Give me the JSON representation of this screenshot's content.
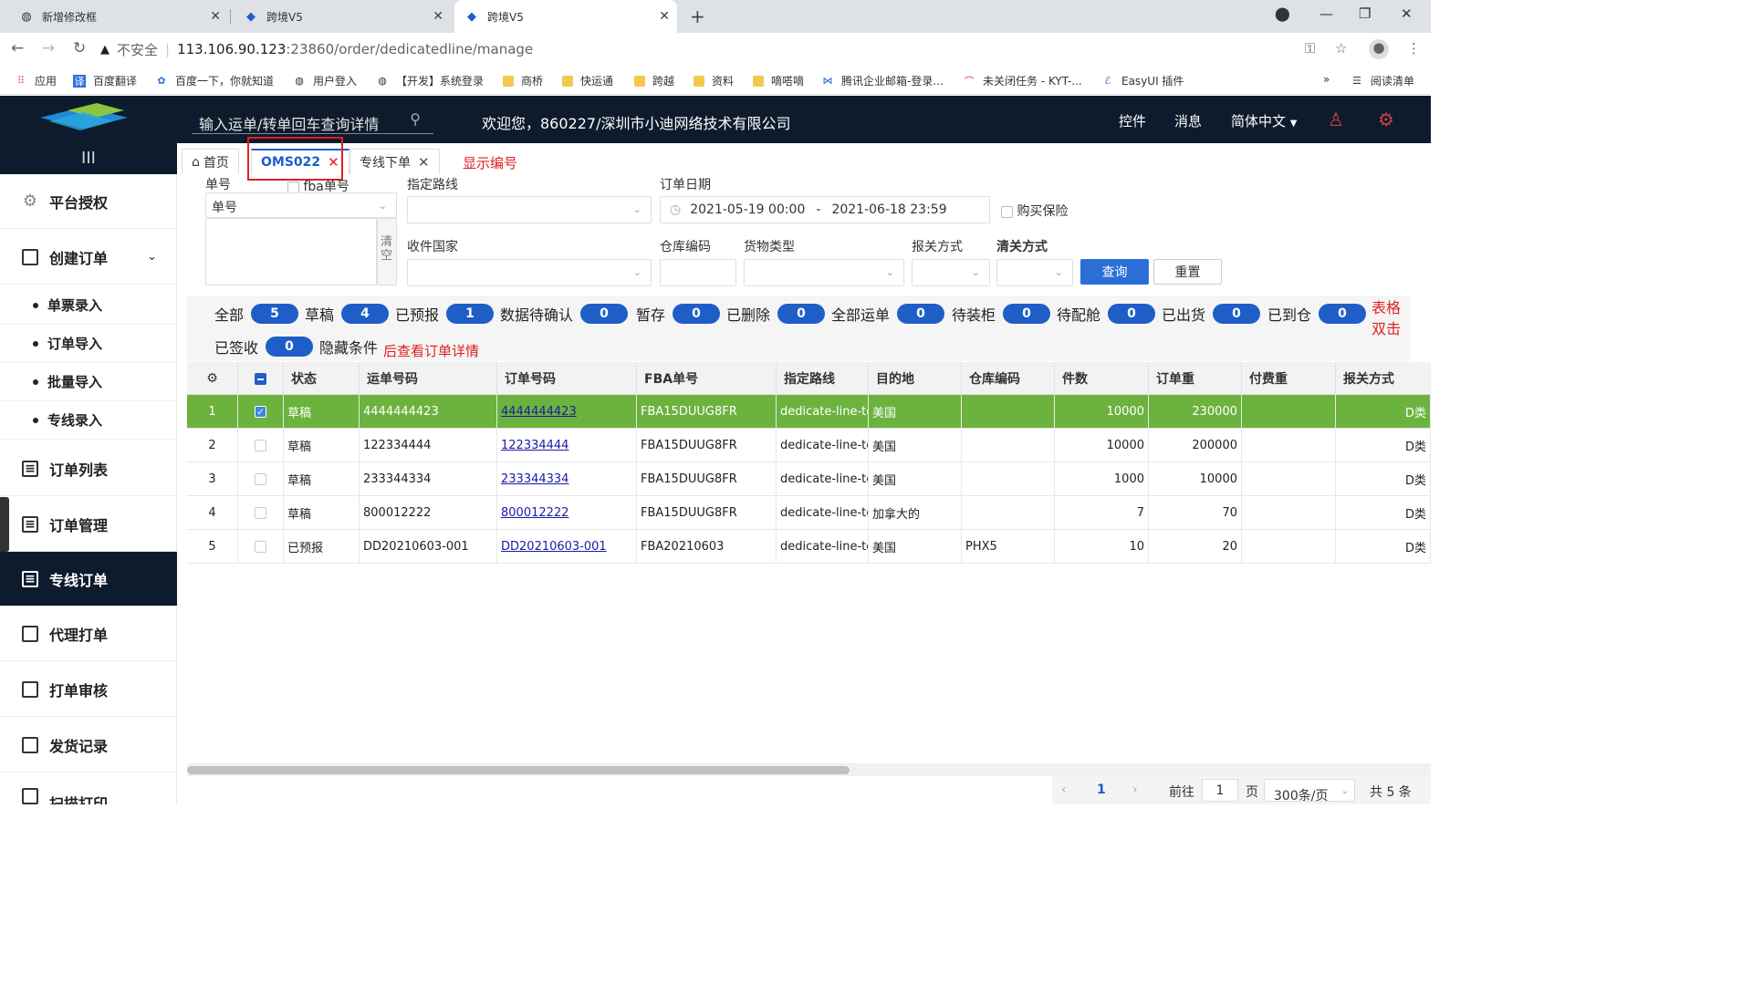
{
  "browser": {
    "tabs": [
      {
        "title": "新增修改框",
        "active": false
      },
      {
        "title": "跨境V5",
        "active": false
      },
      {
        "title": "跨境V5",
        "active": true
      }
    ],
    "address": {
      "insecure_label": "不安全",
      "host": "113.106.90.123",
      "path": ":23860/order/dedicatedline/manage"
    },
    "bookmarks": [
      "应用",
      "百度翻译",
      "百度一下，你就知道",
      "用户登入",
      "【开发】系统登录",
      "商桥",
      "快运通",
      "跨越",
      "资料",
      "嘀嗒嘀",
      "腾讯企业邮箱-登录...",
      "未关闭任务 - KYT-...",
      "EasyUI 插件"
    ],
    "reading_list": "阅读清单",
    "more": "»"
  },
  "header": {
    "search_placeholder": "输入运单/转单回车查询详情",
    "welcome": "欢迎您，860227/深圳市小迪网络技术有限公司",
    "links": [
      "控件",
      "消息",
      "简体中文"
    ]
  },
  "sidebar": {
    "toggle": "III",
    "items": [
      {
        "label": "平台授权",
        "icon": "gear-icon"
      },
      {
        "label": "创建订单",
        "icon": "form-icon"
      },
      {
        "label": "订单列表",
        "icon": "list-icon"
      },
      {
        "label": "订单管理",
        "icon": "list-icon"
      },
      {
        "label": "专线订单",
        "icon": "list-icon"
      },
      {
        "label": "代理打单",
        "icon": "form-icon"
      },
      {
        "label": "打单审核",
        "icon": "form-icon"
      },
      {
        "label": "发货记录",
        "icon": "doc-icon"
      }
    ],
    "subitems": [
      "单票录入",
      "订单导入",
      "批量导入",
      "专线录入"
    ],
    "cut_item": "扫描打印"
  },
  "pagetabs": [
    {
      "label": "首页",
      "closable": false
    },
    {
      "label": "OMS022",
      "closable": true
    },
    {
      "label": "专线下单",
      "closable": true
    }
  ],
  "notes": {
    "show_number": "显示编号",
    "table_dbl": "表格双击",
    "then_view": "后查看订单详情"
  },
  "filters": {
    "no_label": "单号",
    "fba_label": "fba单号",
    "no_select": "单号",
    "clear": "清空",
    "route_label": "指定路线",
    "date_label": "订单日期",
    "date_start": "2021-05-19 00:00",
    "date_sep": "-",
    "date_end": "2021-06-18 23:59",
    "insurance": "购买保险",
    "country_label": "收件国家",
    "wh_label": "仓库编码",
    "goods_label": "货物类型",
    "customs_label": "报关方式",
    "clearance_label": "清关方式",
    "query": "查询",
    "reset": "重置"
  },
  "statuses": [
    {
      "label": "全部",
      "count": "5"
    },
    {
      "label": "草稿",
      "count": "4"
    },
    {
      "label": "已预报",
      "count": "1"
    },
    {
      "label": "数据待确认",
      "count": "0"
    },
    {
      "label": "暂存",
      "count": "0"
    },
    {
      "label": "已删除",
      "count": "0"
    },
    {
      "label": "全部运单",
      "count": "0"
    },
    {
      "label": "待装柜",
      "count": "0"
    },
    {
      "label": "待配舱",
      "count": "0"
    },
    {
      "label": "已出货",
      "count": "0"
    },
    {
      "label": "已到仓",
      "count": "0"
    },
    {
      "label": "已签收",
      "count": "0"
    }
  ],
  "hide_cond": "隐藏条件",
  "table": {
    "columns": [
      "状态",
      "运单号码",
      "订单号码",
      "FBA单号",
      "指定路线",
      "目的地",
      "仓库编码",
      "件数",
      "订单重",
      "付费重",
      "报关方式"
    ],
    "rows": [
      {
        "no": "1",
        "status": "草稿",
        "waybill": "4444444423",
        "order": "4444444423",
        "fba": "FBA15DUUG8FR",
        "route": "dedicate-line-test",
        "dest": "美国",
        "wh": "",
        "pcs": "10000",
        "weight": "230000",
        "pay": "",
        "customs": "D类",
        "checked": true
      },
      {
        "no": "2",
        "status": "草稿",
        "waybill": "122334444",
        "order": "122334444",
        "fba": "FBA15DUUG8FR",
        "route": "dedicate-line-test",
        "dest": "美国",
        "wh": "",
        "pcs": "10000",
        "weight": "200000",
        "pay": "",
        "customs": "D类",
        "checked": false
      },
      {
        "no": "3",
        "status": "草稿",
        "waybill": "233344334",
        "order": "233344334",
        "fba": "FBA15DUUG8FR",
        "route": "dedicate-line-test",
        "dest": "美国",
        "wh": "",
        "pcs": "1000",
        "weight": "10000",
        "pay": "",
        "customs": "D类",
        "checked": false
      },
      {
        "no": "4",
        "status": "草稿",
        "waybill": "800012222",
        "order": "800012222",
        "fba": "FBA15DUUG8FR",
        "route": "dedicate-line-test",
        "dest": "加拿大的",
        "wh": "",
        "pcs": "7",
        "weight": "70",
        "pay": "",
        "customs": "D类",
        "checked": false
      },
      {
        "no": "5",
        "status": "已预报",
        "waybill": "DD20210603-001",
        "order": "DD20210603-001",
        "fba": "FBA20210603",
        "route": "dedicate-line-test",
        "dest": "美国",
        "wh": "PHX5",
        "pcs": "10",
        "weight": "20",
        "pay": "",
        "customs": "D类",
        "checked": false
      }
    ]
  },
  "pager": {
    "page": "1",
    "goto_label": "前往",
    "goto_value": "1",
    "page_unit": "页",
    "size": "300条/页",
    "total": "共 5 条"
  },
  "colors": {
    "nav": "#0d1b2c",
    "primary": "#2b6fd6",
    "selected_row": "#6cb33e",
    "annotation": "#e02020"
  }
}
